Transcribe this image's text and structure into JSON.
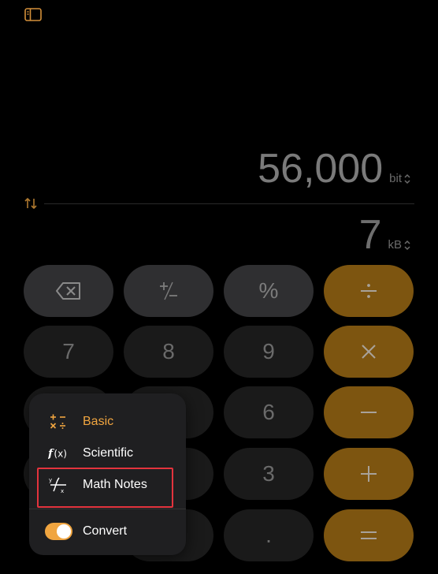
{
  "display": {
    "primary_value": "56,000",
    "primary_unit": "bit",
    "secondary_value": "7",
    "secondary_unit": "kB",
    "unit_chevron": "⌃⌄"
  },
  "keys": {
    "percent": "%",
    "seven": "7",
    "eight": "8",
    "nine": "9",
    "six": "6",
    "three": "3",
    "decimal": "."
  },
  "menu": {
    "items": [
      {
        "label": "Basic",
        "icon": "basic-ops-icon",
        "active": true
      },
      {
        "label": "Scientific",
        "icon": "function-icon",
        "active": false
      },
      {
        "label": "Math Notes",
        "icon": "math-notes-icon",
        "active": false
      }
    ],
    "convert_label": "Convert",
    "convert_enabled": true
  },
  "colors": {
    "accent": "#f0a540",
    "operator_key": "#7d5510",
    "highlight": "#e3333d"
  }
}
